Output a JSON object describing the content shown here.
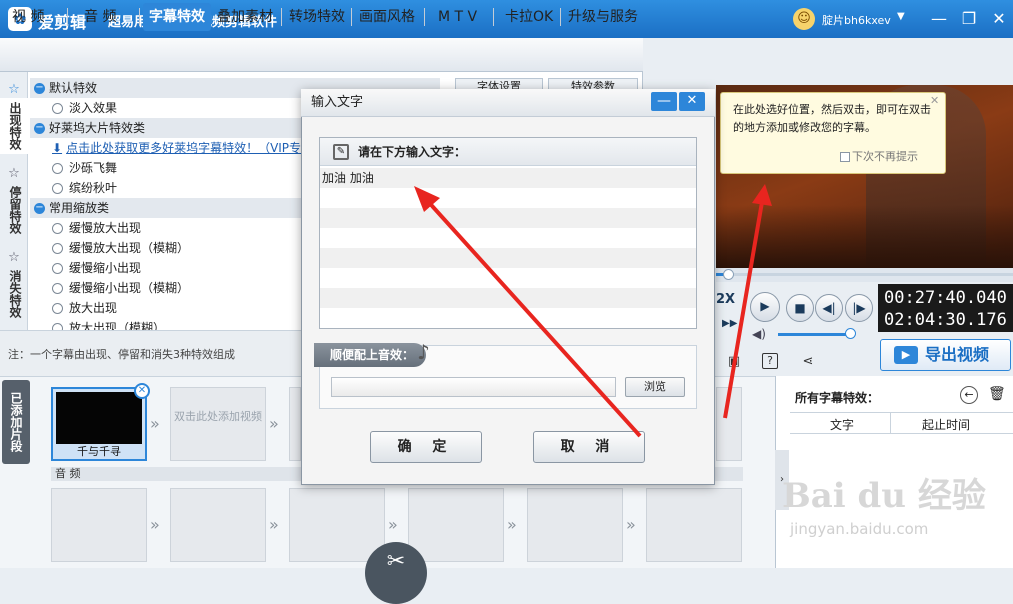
{
  "app": {
    "name": "爱剪辑",
    "slogan": "超易用、强大的视频剪辑软件",
    "logo_icon": "film-reel-icon"
  },
  "user": {
    "name": "腚片bh6kxev"
  },
  "tabs": [
    "视 频",
    "音 频",
    "字幕特效",
    "叠加素材",
    "转场特效",
    "画面风格",
    "M T V",
    "卡拉OK",
    "升级与服务"
  ],
  "active_tab": "字幕特效",
  "side_tabs": [
    "出现特效",
    "停留特效",
    "消失特效"
  ],
  "effect_panel": {
    "font_settings": "字体设置",
    "effect_params": "特效参数",
    "groups": [
      {
        "name": "默认特效",
        "items": [
          "淡入效果"
        ]
      },
      {
        "name": "好莱坞大片特效类",
        "link": "点击此处获取更多好莱坞字幕特效！（VIP专",
        "items": [
          "沙砾飞舞",
          "缤纷秋叶"
        ]
      },
      {
        "name": "常用缩放类",
        "items": [
          "缓慢放大出现",
          "缓慢放大出现（模糊）",
          "缓慢缩小出现",
          "缓慢缩小出现（模糊）",
          "放大出现",
          "放大出现（模糊）"
        ]
      }
    ],
    "note": "注：一个字幕由出现、停留和消失3种特效组成"
  },
  "preview": {
    "tip": "在此处选好位置，然后双击，即可在双击的地方添加或修改您的字幕。",
    "tip_checkbox": "下次不再提示",
    "speed": "2X",
    "time_current": "00:27:40.040",
    "time_total": "02:04:30.176",
    "export_label": "导出视频",
    "progress": 0.04,
    "volume": 0.9
  },
  "timeline": {
    "added_label": "已添加片段",
    "clip_label": "千与千寻",
    "empty_slot": "双击此处添加视频",
    "audio_label": "音 频"
  },
  "subtitles": {
    "header": "所有字幕特效：",
    "col_text": "文字",
    "col_time": "起止时间"
  },
  "watermark": {
    "brand": "Bai du 经验",
    "url": "jingyan.baidu.com"
  },
  "dialog": {
    "title": "输入文字",
    "input_header": "请在下方输入文字：",
    "input_text": "加油    加油",
    "sound_label": "顺便配上音效：",
    "browse": "浏览",
    "ok": "确 定",
    "cancel": "取 消"
  },
  "colors": {
    "accent": "#2d86d9",
    "annotation": "#e8251f"
  }
}
